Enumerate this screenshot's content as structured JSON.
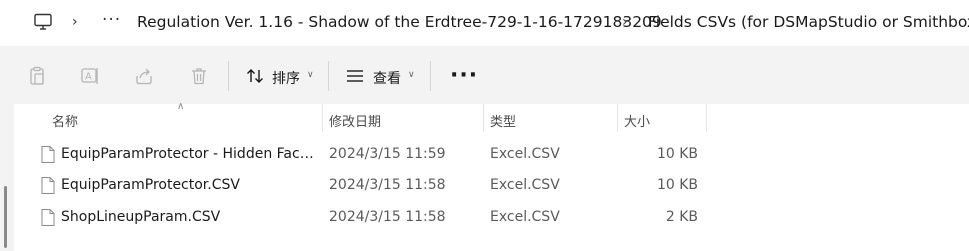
{
  "address_bar": {
    "ellipsis": "···",
    "breadcrumbs": [
      "Regulation Ver. 1.16 - Shadow of the Erdtree-729-1-16-1729183209",
      "Fields CSVs (for DSMapStudio or Smithbox)"
    ]
  },
  "toolbar": {
    "sort_label": "排序",
    "view_label": "查看",
    "more_label": "···"
  },
  "columns": {
    "name": "名称",
    "date": "修改日期",
    "type": "类型",
    "size": "大小"
  },
  "files": [
    {
      "name": "EquipParamProtector - Hidden Face....",
      "date": "2024/3/15 11:59",
      "type": "Excel.CSV",
      "size": "10 KB"
    },
    {
      "name": "EquipParamProtector.CSV",
      "date": "2024/3/15 11:58",
      "type": "Excel.CSV",
      "size": "10 KB"
    },
    {
      "name": "ShopLineupParam.CSV",
      "date": "2024/3/15 11:58",
      "type": "Excel.CSV",
      "size": "2 KB"
    }
  ]
}
